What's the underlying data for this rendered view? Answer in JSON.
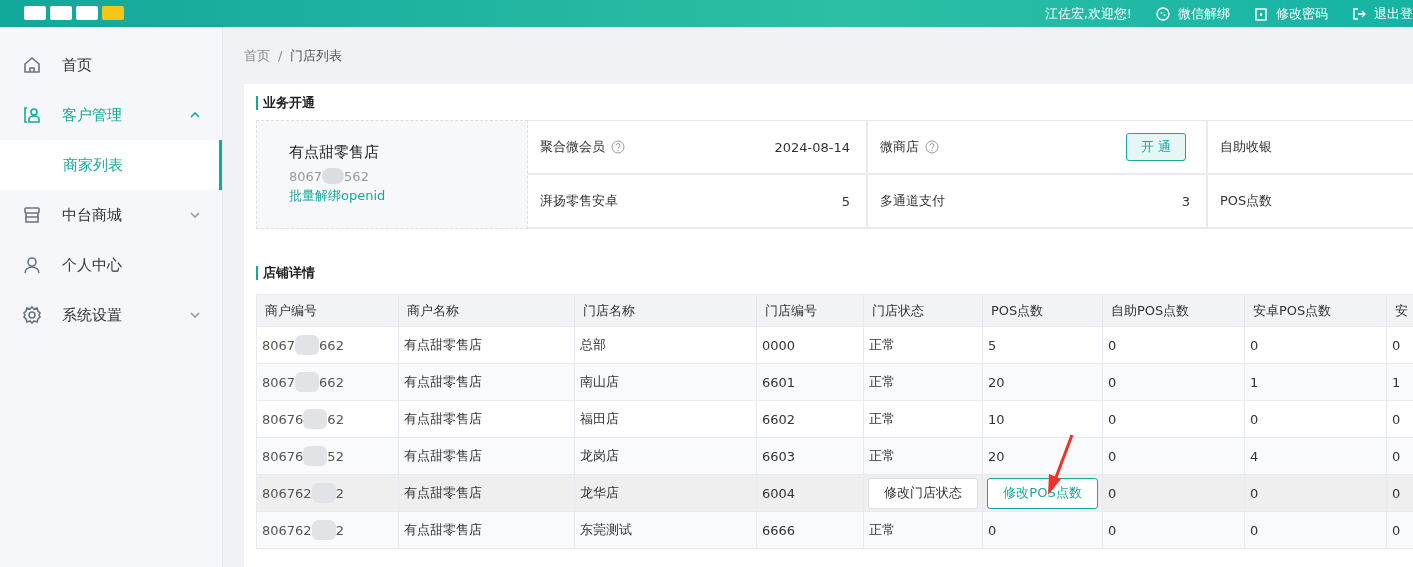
{
  "header": {
    "welcome": "江佐宏,欢迎您!",
    "actions": [
      {
        "kind": "wechat",
        "label": "微信解绑"
      },
      {
        "kind": "lock",
        "label": "修改密码"
      },
      {
        "kind": "exit",
        "label": "退出登"
      }
    ]
  },
  "sidebar": {
    "items": [
      {
        "kind": "home",
        "label": "首页",
        "selected": false
      },
      {
        "kind": "customer",
        "label": "客户管理",
        "selected": true,
        "expanded": true,
        "children": [
          {
            "label": "商家列表",
            "selected": true
          }
        ]
      },
      {
        "kind": "store",
        "label": "中台商城",
        "selected": false,
        "expanded": false
      },
      {
        "kind": "person",
        "label": "个人中心",
        "selected": false
      },
      {
        "kind": "gear",
        "label": "系统设置",
        "selected": false,
        "expanded": false
      }
    ]
  },
  "breadcrumb": {
    "separator": "/",
    "items": [
      "首页",
      "门店列表"
    ]
  },
  "business": {
    "title": "业务开通",
    "store_name": "有点甜零售店",
    "merchant_id_start": "8067",
    "merchant_id_end": "562",
    "link": "批量解绑openid",
    "services": [
      {
        "name": "聚合微会员",
        "help": true,
        "kind": "value",
        "value": "2024-08-14"
      },
      {
        "name": "微商店",
        "help": true,
        "kind": "button",
        "value": "开 通"
      },
      {
        "name": "自助收银",
        "help": false,
        "kind": "none"
      },
      {
        "name": "湃扬零售安卓",
        "help": false,
        "kind": "value",
        "value": "5"
      },
      {
        "name": "多通道支付",
        "help": false,
        "kind": "value",
        "value": "3"
      },
      {
        "name": "POS点数",
        "help": false,
        "kind": "none"
      }
    ]
  },
  "stores": {
    "title": "店铺详情",
    "columns": [
      "商户编号",
      "商户名称",
      "门店名称",
      "门店编号",
      "门店状态",
      "POS点数",
      "自助POS点数",
      "安卓POS点数",
      "安"
    ],
    "rows": [
      {
        "hovered": false,
        "cells": [
          {
            "kind": "masked",
            "start": "8067",
            "end": "662"
          },
          {
            "kind": "text",
            "text": "有点甜零售店"
          },
          {
            "kind": "text",
            "text": "总部"
          },
          {
            "kind": "text",
            "text": "0000"
          },
          {
            "kind": "text",
            "text": "正常"
          },
          {
            "kind": "text",
            "text": "5"
          },
          {
            "kind": "text",
            "text": "0"
          },
          {
            "kind": "text",
            "text": "0"
          },
          {
            "kind": "text",
            "text": "0"
          }
        ]
      },
      {
        "hovered": false,
        "cells": [
          {
            "kind": "masked",
            "start": "8067",
            "end": "662"
          },
          {
            "kind": "text",
            "text": "有点甜零售店"
          },
          {
            "kind": "text",
            "text": "南山店"
          },
          {
            "kind": "text",
            "text": "6601"
          },
          {
            "kind": "text",
            "text": "正常"
          },
          {
            "kind": "text",
            "text": "20"
          },
          {
            "kind": "text",
            "text": "0"
          },
          {
            "kind": "text",
            "text": "1"
          },
          {
            "kind": "text",
            "text": "1"
          }
        ]
      },
      {
        "hovered": false,
        "cells": [
          {
            "kind": "masked",
            "start": "80676",
            "end": "62"
          },
          {
            "kind": "text",
            "text": "有点甜零售店"
          },
          {
            "kind": "text",
            "text": "福田店"
          },
          {
            "kind": "text",
            "text": "6602"
          },
          {
            "kind": "text",
            "text": "正常"
          },
          {
            "kind": "text",
            "text": "10"
          },
          {
            "kind": "text",
            "text": "0"
          },
          {
            "kind": "text",
            "text": "0"
          },
          {
            "kind": "text",
            "text": "0"
          }
        ]
      },
      {
        "hovered": false,
        "cells": [
          {
            "kind": "masked",
            "start": "80676",
            "end": "52"
          },
          {
            "kind": "text",
            "text": "有点甜零售店"
          },
          {
            "kind": "text",
            "text": "龙岗店"
          },
          {
            "kind": "text",
            "text": "6603"
          },
          {
            "kind": "text",
            "text": "正常"
          },
          {
            "kind": "text",
            "text": "20"
          },
          {
            "kind": "text",
            "text": "0"
          },
          {
            "kind": "text",
            "text": "4"
          },
          {
            "kind": "text",
            "text": "0"
          }
        ]
      },
      {
        "hovered": true,
        "cells": [
          {
            "kind": "masked",
            "start": "806762",
            "end": "2"
          },
          {
            "kind": "text",
            "text": "有点甜零售店"
          },
          {
            "kind": "text",
            "text": "龙华店"
          },
          {
            "kind": "text",
            "text": "6004"
          },
          {
            "kind": "button",
            "text": "修改门店状态",
            "highlighted": false
          },
          {
            "kind": "button",
            "text": "修改POS点数",
            "highlighted": true
          },
          {
            "kind": "text",
            "text": "0"
          },
          {
            "kind": "text",
            "text": "0"
          },
          {
            "kind": "text",
            "text": "0"
          }
        ]
      },
      {
        "hovered": false,
        "cells": [
          {
            "kind": "masked",
            "start": "806762",
            "end": "2"
          },
          {
            "kind": "text",
            "text": "有点甜零售店"
          },
          {
            "kind": "text",
            "text": "东莞测试"
          },
          {
            "kind": "text",
            "text": "6666"
          },
          {
            "kind": "text",
            "text": "正常"
          },
          {
            "kind": "text",
            "text": "0"
          },
          {
            "kind": "text",
            "text": "0"
          },
          {
            "kind": "text",
            "text": "0"
          },
          {
            "kind": "text",
            "text": "0"
          }
        ]
      }
    ]
  }
}
